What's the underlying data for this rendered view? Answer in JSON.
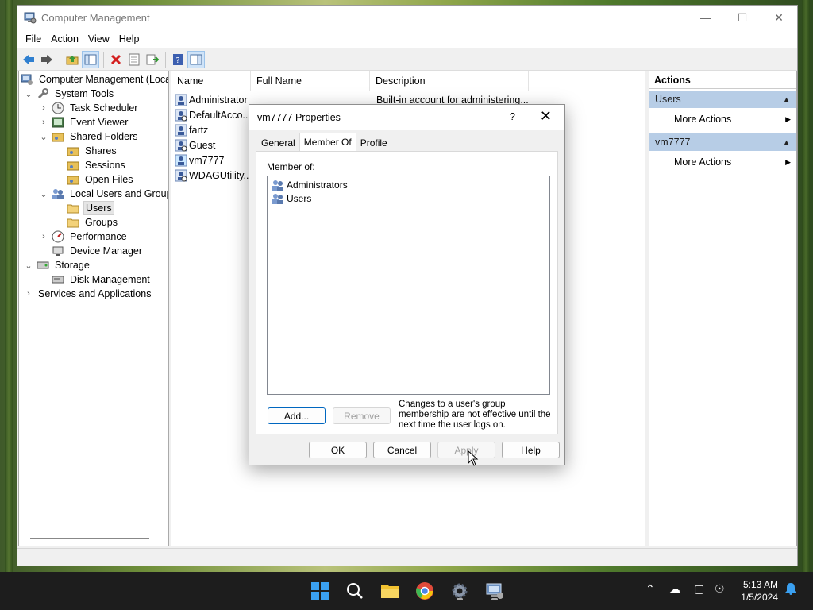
{
  "window": {
    "title": "Computer Management",
    "menus": [
      "File",
      "Action",
      "View",
      "Help"
    ]
  },
  "tree": {
    "root": "Computer Management (Local",
    "system_tools": "System Tools",
    "task_scheduler": "Task Scheduler",
    "event_viewer": "Event Viewer",
    "shared_folders": "Shared Folders",
    "shares": "Shares",
    "sessions": "Sessions",
    "open_files": "Open Files",
    "local_users_groups": "Local Users and Groups",
    "users": "Users",
    "groups": "Groups",
    "performance": "Performance",
    "device_manager": "Device Manager",
    "storage": "Storage",
    "disk_management": "Disk Management",
    "services_apps": "Services and Applications"
  },
  "list": {
    "columns": [
      "Name",
      "Full Name",
      "Description"
    ],
    "rows": [
      {
        "name": "Administrator",
        "description": "Built-in account for administering..."
      },
      {
        "name": "DefaultAcco...",
        "description": ""
      },
      {
        "name": "fartz",
        "description": ""
      },
      {
        "name": "Guest",
        "description": ""
      },
      {
        "name": "vm7777",
        "description": ""
      },
      {
        "name": "WDAGUtility...",
        "description": ""
      }
    ]
  },
  "actions": {
    "title": "Actions",
    "sections": [
      {
        "label": "Users",
        "item": "More Actions"
      },
      {
        "label": "vm7777",
        "item": "More Actions"
      }
    ]
  },
  "dialog": {
    "title": "vm7777 Properties",
    "help_glyph": "?",
    "tabs": [
      "General",
      "Member Of",
      "Profile"
    ],
    "member_of_label": "Member of:",
    "members": [
      "Administrators",
      "Users"
    ],
    "add_label": "Add...",
    "remove_label": "Remove",
    "note": "Changes to a user's group membership are not effective until the next time the user logs on.",
    "ok_label": "OK",
    "cancel_label": "Cancel",
    "apply_label": "Apply",
    "help_label": "Help"
  },
  "taskbar": {
    "time": "5:13 AM",
    "date": "1/5/2024"
  },
  "colors": {
    "selection": "#cce8ff",
    "actions_header": "#b7cde6",
    "accent": "#0067c0"
  }
}
